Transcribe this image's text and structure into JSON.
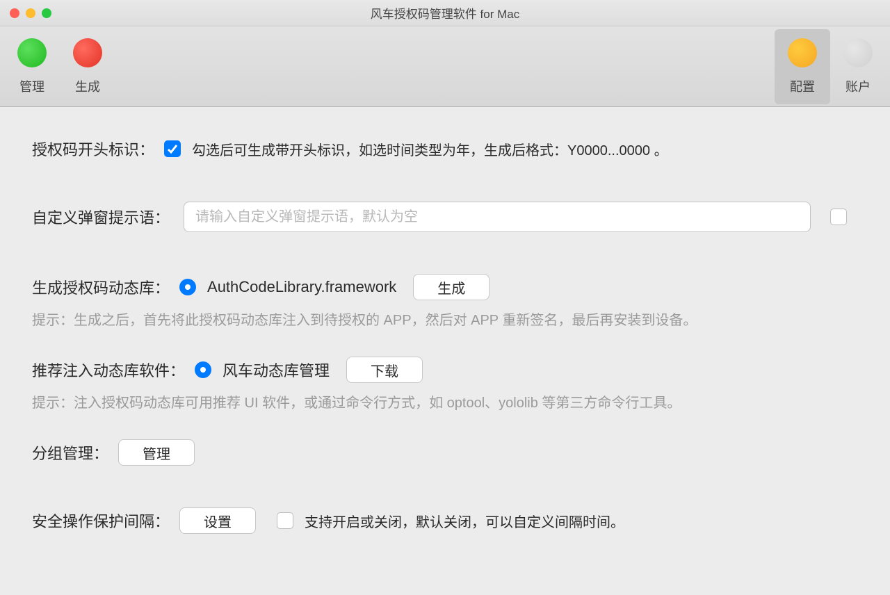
{
  "window": {
    "title": "风车授权码管理软件 for Mac"
  },
  "toolbar": {
    "left": [
      {
        "id": "manage",
        "label": "管理",
        "color": "green"
      },
      {
        "id": "generate",
        "label": "生成",
        "color": "red"
      }
    ],
    "right": [
      {
        "id": "config",
        "label": "配置",
        "color": "orange",
        "selected": true
      },
      {
        "id": "account",
        "label": "账户",
        "color": "gray",
        "selected": false
      }
    ]
  },
  "rows": {
    "prefix": {
      "label": "授权码开头标识：",
      "checked": true,
      "desc": "勾选后可生成带开头标识，如选时间类型为年，生成后格式：Y0000...0000 。"
    },
    "popup": {
      "label": "自定义弹窗提示语：",
      "placeholder": "请输入自定义弹窗提示语，默认为空",
      "checkbox_checked": false
    },
    "genlib": {
      "label": "生成授权码动态库：",
      "lib_name": "AuthCodeLibrary.framework",
      "button": "生成",
      "hint": "提示：生成之后，首先将此授权码动态库注入到待授权的 APP，然后对 APP 重新签名，最后再安装到设备。"
    },
    "inject": {
      "label": "推荐注入动态库软件：",
      "lib_name": "风车动态库管理",
      "button": "下载",
      "hint": "提示：注入授权码动态库可用推荐 UI 软件，或通过命令行方式，如 optool、yololib 等第三方命令行工具。"
    },
    "group": {
      "label": "分组管理：",
      "button": "管理"
    },
    "safety": {
      "label": "安全操作保护间隔：",
      "button": "设置",
      "checkbox_checked": false,
      "desc": "支持开启或关闭，默认关闭，可以自定义间隔时间。"
    }
  }
}
